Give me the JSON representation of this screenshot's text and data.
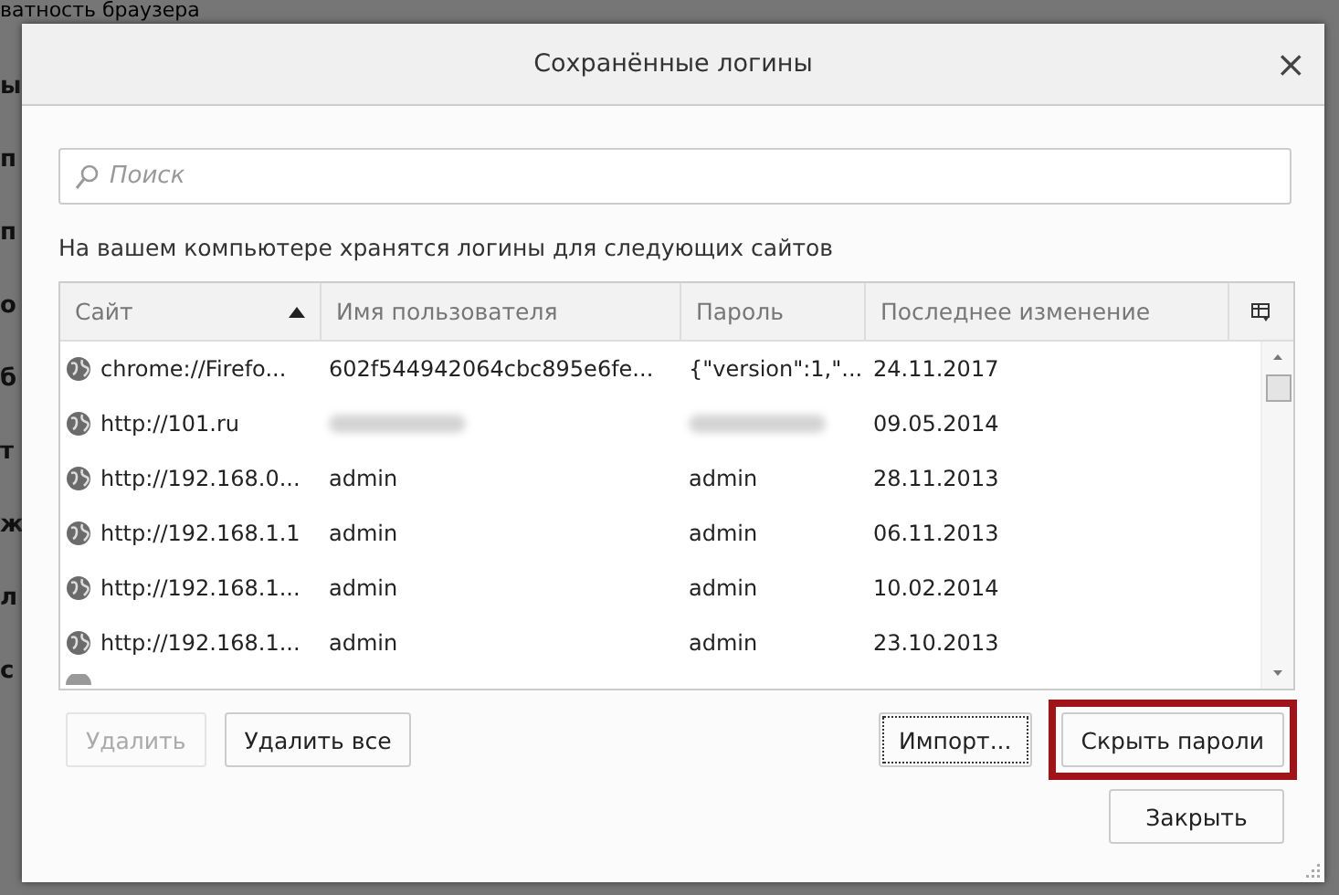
{
  "background": {
    "heading": "ватность браузера",
    "fragments": [
      "ы",
      "п",
      "п",
      "о",
      "б",
      "т",
      "ж",
      "л",
      "с"
    ]
  },
  "dialog": {
    "title": "Сохранённые логины",
    "close": "×"
  },
  "search": {
    "placeholder": "Поиск"
  },
  "description": "На вашем компьютере хранятся логины для следующих сайтов",
  "table": {
    "columns": [
      {
        "label": "Сайт",
        "sorted": true
      },
      {
        "label": "Имя пользователя",
        "sorted": false
      },
      {
        "label": "Пароль",
        "sorted": false
      },
      {
        "label": "Последнее изменение",
        "sorted": false
      }
    ],
    "rows": [
      {
        "cells": [
          {
            "text": "chrome://Firefo..."
          },
          {
            "text": "602f544942064cbc895e6fe..."
          },
          {
            "text": "{\"version\":1,\"..."
          },
          {
            "text": "24.11.2017"
          }
        ]
      },
      {
        "cells": [
          {
            "text": "http://101.ru"
          },
          {
            "kind": "blurred"
          },
          {
            "kind": "blurred"
          },
          {
            "text": "09.05.2014"
          }
        ]
      },
      {
        "cells": [
          {
            "text": "http://192.168.0..."
          },
          {
            "text": "admin"
          },
          {
            "text": "admin"
          },
          {
            "text": "28.11.2013"
          }
        ]
      },
      {
        "cells": [
          {
            "text": "http://192.168.1.1"
          },
          {
            "text": "admin"
          },
          {
            "text": "admin"
          },
          {
            "text": "06.11.2013"
          }
        ]
      },
      {
        "cells": [
          {
            "text": "http://192.168.1..."
          },
          {
            "text": "admin"
          },
          {
            "text": "admin"
          },
          {
            "text": "10.02.2014"
          }
        ]
      },
      {
        "cells": [
          {
            "text": "http://192.168.1..."
          },
          {
            "text": "admin"
          },
          {
            "text": "admin"
          },
          {
            "text": "23.10.2013"
          }
        ]
      }
    ]
  },
  "buttons_left": [
    {
      "label": "Удалить",
      "disabled": true
    },
    {
      "label": "Удалить все",
      "disabled": false
    }
  ],
  "buttons_right": [
    {
      "label": "Импорт...",
      "focused": true,
      "highlighted": false
    },
    {
      "label": "Скрыть пароли",
      "focused": false,
      "highlighted": true
    }
  ],
  "close_button": {
    "label": "Закрыть"
  }
}
